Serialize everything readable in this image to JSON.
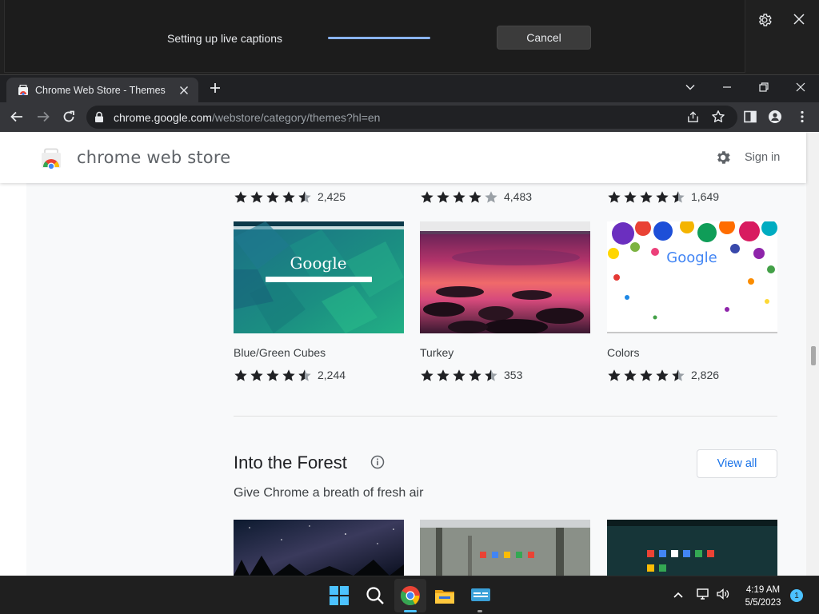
{
  "live_caption": {
    "status_text": "Setting up live captions",
    "progress": 1.0,
    "cancel_label": "Cancel"
  },
  "browser": {
    "tab_title": "Chrome Web Store - Themes",
    "url_host": "chrome.google.com",
    "url_path": "/webstore/category/themes?hl=en"
  },
  "store": {
    "title": "chrome web store",
    "sign_in_label": "Sign in"
  },
  "top_ratings": [
    {
      "stars": 4.5,
      "count": "2,425"
    },
    {
      "stars": 4,
      "count": "4,483"
    },
    {
      "stars": 4.5,
      "count": "1,649"
    }
  ],
  "themes": [
    {
      "name": "Blue/Green Cubes",
      "stars": 4.5,
      "count": "2,244",
      "thumb_logo": "Google"
    },
    {
      "name": "Turkey",
      "stars": 4.5,
      "count": "353"
    },
    {
      "name": "Colors",
      "stars": 4.5,
      "count": "2,826",
      "thumb_logo": "Google"
    }
  ],
  "section": {
    "title": "Into the Forest",
    "subtitle": "Give Chrome a breath of fresh air",
    "view_all_label": "View all"
  },
  "taskbar": {
    "time": "4:19 AM",
    "date": "5/5/2023",
    "notification_count": "1"
  },
  "colors": {
    "star": "#202124",
    "link_blue": "#1a73e8",
    "caption_progress": "#8ab4f8"
  }
}
